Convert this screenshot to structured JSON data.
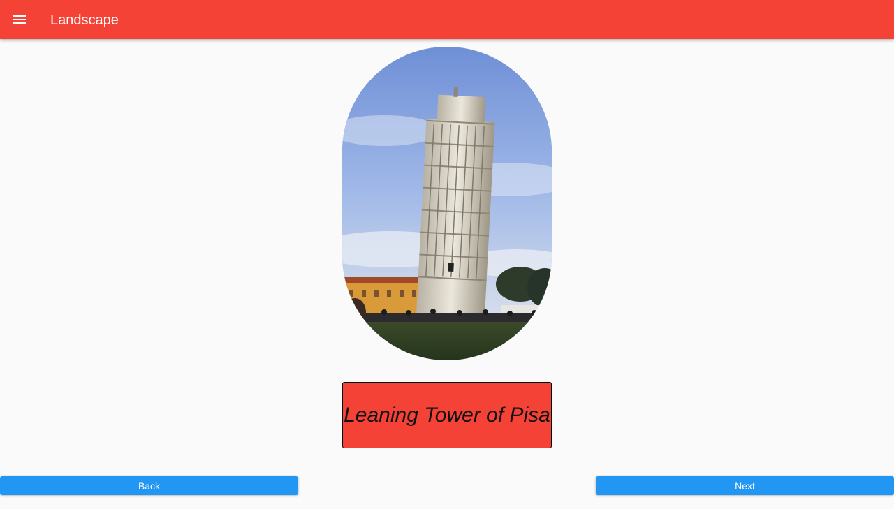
{
  "appbar": {
    "title": "Landscape",
    "menu_icon": "menu-icon",
    "color": "#f44336"
  },
  "photo": {
    "subject": "leaning-tower-photo"
  },
  "caption": {
    "text": "Leaning Tower of Pisa",
    "background": "#f44336"
  },
  "navigation": {
    "back_label": "Back",
    "next_label": "Next",
    "button_color": "#2196f3"
  }
}
